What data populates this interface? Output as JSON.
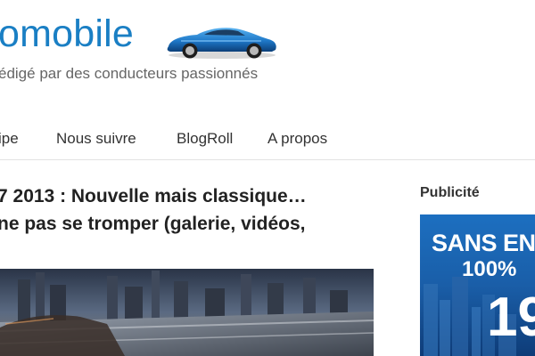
{
  "header": {
    "logo_text": "omobile",
    "tagline": "édigé par des conducteurs passionnés",
    "logo_car_icon": "sports-car-icon",
    "brand_color": "#1a7fc4"
  },
  "nav": {
    "items": [
      {
        "label": "ipe"
      },
      {
        "label": "Nous suivre"
      },
      {
        "label": "BlogRoll"
      },
      {
        "label": "A propos"
      }
    ]
  },
  "article": {
    "title_line_1": "7 2013 : Nouvelle mais classique…",
    "title_line_2": "ne pas se tromper (galerie, vidéos,"
  },
  "sidebar": {
    "heading": "Publicité",
    "ad": {
      "line_1": "SANS EN",
      "line_2": "100%",
      "line_3": "19"
    }
  }
}
